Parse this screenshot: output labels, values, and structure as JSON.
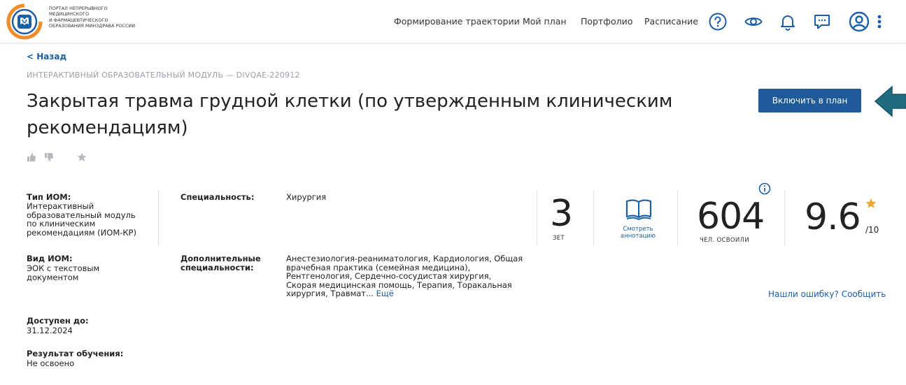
{
  "header": {
    "logo_lines": [
      "ПОРТАЛ НЕПРЕРЫВНОГО",
      "МЕДИЦИНСКОГО",
      "И ФАРМАЦЕВТИЧЕСКОГО",
      "ОБРАЗОВАНИЯ МИНЗДРАВА РОССИИ"
    ],
    "nav": [
      "Формирование траектории",
      "Мой план",
      "Портфолио",
      "Расписание"
    ],
    "icons": [
      "help-icon",
      "eye-icon",
      "bell-icon",
      "chat-icon",
      "user-icon",
      "more-vertical-icon"
    ],
    "accent": "#1b5ea8",
    "logo_orange": "#f28c28"
  },
  "page": {
    "back": "< Назад",
    "breadcrumb": "ИНТЕРАКТИВНЫЙ ОБРАЗОВАТЕЛЬНЫЙ МОДУЛЬ — DIVQAE-220912",
    "title": "Закрытая травма грудной клетки (по утвержденным клиническим рекомендациям)",
    "cta": "Включить в план",
    "cta_color": "#1f5b9a"
  },
  "details": {
    "type_label": "Тип ИОМ:",
    "type_value": "Интерактивный образовательный модуль по клиническим рекомендациям (ИОМ-КР)",
    "kind_label": "Вид ИОМ:",
    "kind_value": "ЭОК с текстовым документом",
    "available_label": "Доступен до:",
    "available_value": "31.12.2024",
    "result_label": "Результат обучения:",
    "result_value": "Не освоено",
    "specialty_label": "Специальность:",
    "specialty_value": "Хирургия",
    "extra_label": "Дополнительные специальности:",
    "extra_value": "Анестезиология-реаниматология, Кардиология, Общая врачебная практика (семейная медицина), Рентгенология, Сердечно-сосудистая хирургия, Скорая медицинская помощь, Терапия, Торакальная хирургия, Травмат...",
    "extra_more": "Ещё"
  },
  "stats": {
    "zet_value": "3",
    "zet_label": "ЗЕТ",
    "annotation_link": "Смотреть аннотацию",
    "learners_value": "604",
    "learners_label": "ЧЕЛ. ОСВОИЛИ",
    "rating_value": "9.6",
    "rating_max": "/10",
    "star_color": "#f0a830",
    "report_link": "Нашли ошибку? Сообщить"
  }
}
